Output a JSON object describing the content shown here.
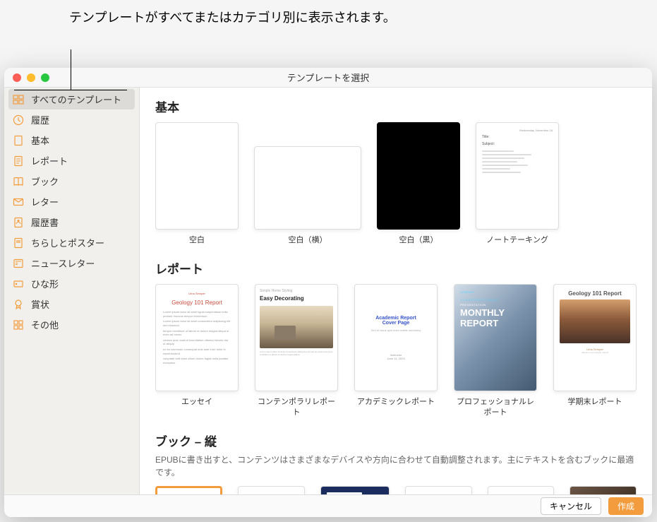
{
  "annotation": "テンプレートがすべてまたはカテゴリ別に表示されます。",
  "window": {
    "title": "テンプレートを選択"
  },
  "sidebar": {
    "items": [
      {
        "label": "すべてのテンプレート",
        "icon": "grid",
        "selected": true
      },
      {
        "label": "履歴",
        "icon": "clock",
        "selected": false
      },
      {
        "label": "基本",
        "icon": "doc",
        "selected": false
      },
      {
        "label": "レポート",
        "icon": "report",
        "selected": false
      },
      {
        "label": "ブック",
        "icon": "book",
        "selected": false
      },
      {
        "label": "レター",
        "icon": "mail",
        "selected": false
      },
      {
        "label": "履歴書",
        "icon": "person",
        "selected": false
      },
      {
        "label": "ちらしとポスター",
        "icon": "poster",
        "selected": false
      },
      {
        "label": "ニュースレター",
        "icon": "news",
        "selected": false
      },
      {
        "label": "ひな形",
        "icon": "card",
        "selected": false
      },
      {
        "label": "賞状",
        "icon": "ribbon",
        "selected": false
      },
      {
        "label": "その他",
        "icon": "grid2",
        "selected": false
      }
    ]
  },
  "sections": {
    "basic": {
      "title": "基本",
      "templates": [
        {
          "label": "空白"
        },
        {
          "label": "空白（横）"
        },
        {
          "label": "空白（黒）"
        },
        {
          "label": "ノートテーキング"
        }
      ]
    },
    "report": {
      "title": "レポート",
      "templates": [
        {
          "label": "エッセイ",
          "preview_title": "Geology 101 Report"
        },
        {
          "label": "コンテンポラリレポート",
          "preview_heading": "Simple Home Styling",
          "preview_title": "Easy Decorating"
        },
        {
          "label": "アカデミックレポート",
          "preview_title1": "Academic Report",
          "preview_title2": "Cover Page"
        },
        {
          "label": "プロフェッショナルレポート",
          "preview_heading": "SUNDERSEETSHART",
          "preview_title": "MONTHLY",
          "preview_title2": "REPORT"
        },
        {
          "label": "学期末レポート",
          "preview_title": "Geology 101 Report"
        }
      ]
    },
    "book": {
      "title": "ブック – 縦",
      "subtitle": "EPUBに書き出すと、コンテンツはさまざまなデバイスや方向に合わせて自動調整されます。主にテキストを含むブックに最適です。"
    }
  },
  "footer": {
    "cancel": "キャンセル",
    "create": "作成"
  }
}
